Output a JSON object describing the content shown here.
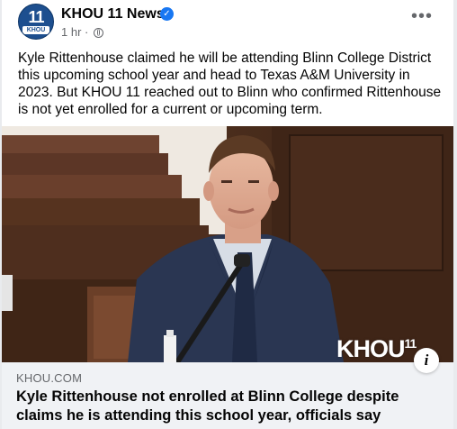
{
  "header": {
    "avatar_number": "11",
    "avatar_band": "KHOU",
    "page_name": "KHOU 11 News",
    "verified_glyph": "✓",
    "timestamp": "1 hr",
    "separator": "·",
    "privacy_icon": "globe-icon",
    "more_glyph": "•••"
  },
  "post": {
    "text": "Kyle Rittenhouse claimed he will be attending Blinn College District this upcoming school year and head to Texas A&M University in 2023. But KHOU 11 reached out to Blinn who confirmed Rittenhouse is not yet enrolled for a current or upcoming term."
  },
  "media": {
    "watermark": "KHOU",
    "watermark_sup": "11"
  },
  "link": {
    "domain": "KHOU.COM",
    "headline": "Kyle Rittenhouse not enrolled at Blinn College despite claims he is attending this school year, officials say",
    "info_glyph": "i"
  },
  "colors": {
    "brand_blue": "#1877f2",
    "khou_blue": "#1d4f8f",
    "card_bg": "#f0f2f5"
  }
}
